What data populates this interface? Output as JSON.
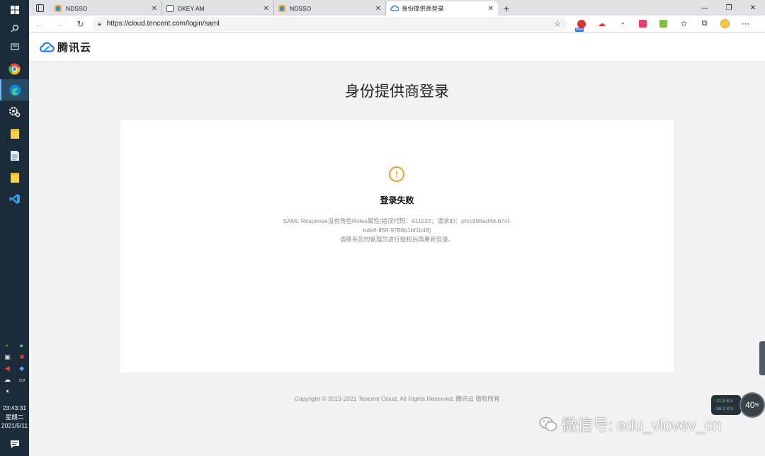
{
  "taskbar": {
    "icons": [
      "windows-start",
      "search",
      "task-view",
      "chrome",
      "edge",
      "settings",
      "sticky-notes",
      "document",
      "sticky-notes-2",
      "vscode"
    ],
    "clock": {
      "time": "23:43:31",
      "weekday": "星期二",
      "date": "2021/5/11"
    }
  },
  "browser": {
    "tabs": [
      {
        "title": "NDSSO",
        "active": false
      },
      {
        "title": "DKEY AM",
        "active": false
      },
      {
        "title": "NDSSO",
        "active": false
      },
      {
        "title": "身份提供商登录",
        "active": true
      }
    ],
    "url": "https://cloud.tencent.com/login/saml",
    "ext_new_badge": "New"
  },
  "page": {
    "logo_text": "腾讯云",
    "title": "身份提供商登录",
    "error_title": "登录失败",
    "error_line1": "SAML Response没有角色Roles属性(错误代码：911022；请求ID：pfxc996ad4d-b7cf-",
    "error_line2": "bde8-ff69-9788b1bf1b48)",
    "error_line3": "请联系您的管理员进行授权后再重新登录。",
    "footer": "Copyright © 2013-2021 Tencent Cloud. All Rights Reserved. 腾讯云 版权所有"
  },
  "overlay": {
    "watermark": "微信号: edu_vlovev_cn",
    "net_up": "↑11.9",
    "net_down": "↓58.2",
    "net_unit": "K/s",
    "cpu": "40",
    "cpu_unit": "%"
  },
  "colors": {
    "taskbar": "#1c2b3a",
    "warning": "#e8a32a",
    "tencent_blue": "#0052d9"
  }
}
